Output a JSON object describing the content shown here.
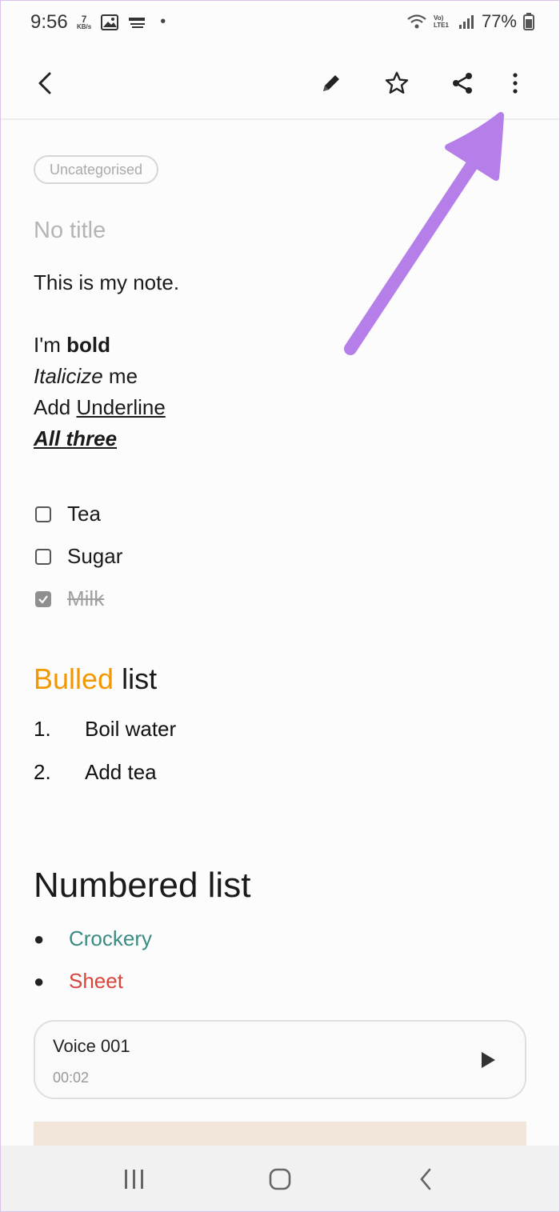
{
  "status_bar": {
    "time": "9:56",
    "data_speed_value": "7",
    "data_speed_unit": "KB/s",
    "network_label": "Vo) LTE1",
    "battery_percent": "77%"
  },
  "toolbar": {
    "icons": [
      "back-arrow-icon",
      "pencil-icon",
      "star-icon",
      "share-icon",
      "more-vertical-icon"
    ]
  },
  "note": {
    "category": "Uncategorised",
    "title_placeholder": "No title",
    "body_line1": "This is my note.",
    "bold_prefix": "I'm ",
    "bold_word": "bold",
    "italic_word": "Italicize",
    "italic_suffix": " me",
    "underline_prefix": "Add ",
    "underline_word": "Underline",
    "all_three": "All three",
    "checklist": [
      {
        "label": "Tea",
        "checked": false
      },
      {
        "label": "Sugar",
        "checked": false
      },
      {
        "label": "Milk",
        "checked": true
      }
    ],
    "bulled_heading_part1": "Bulled",
    "bulled_heading_part2": " list",
    "numbered_items": [
      {
        "num": "1.",
        "text": "Boil water"
      },
      {
        "num": "2.",
        "text": "Add tea"
      }
    ],
    "numbered_heading": "Numbered list",
    "bullet_items": [
      {
        "text": "Crockery",
        "color": "#3a8c82"
      },
      {
        "text": "Sheet",
        "color": "#d9453a"
      }
    ],
    "voice": {
      "title": "Voice 001",
      "duration": "00:02"
    }
  },
  "colors": {
    "heading_accent": "#f39800",
    "annotation_arrow": "#b57ee8"
  }
}
